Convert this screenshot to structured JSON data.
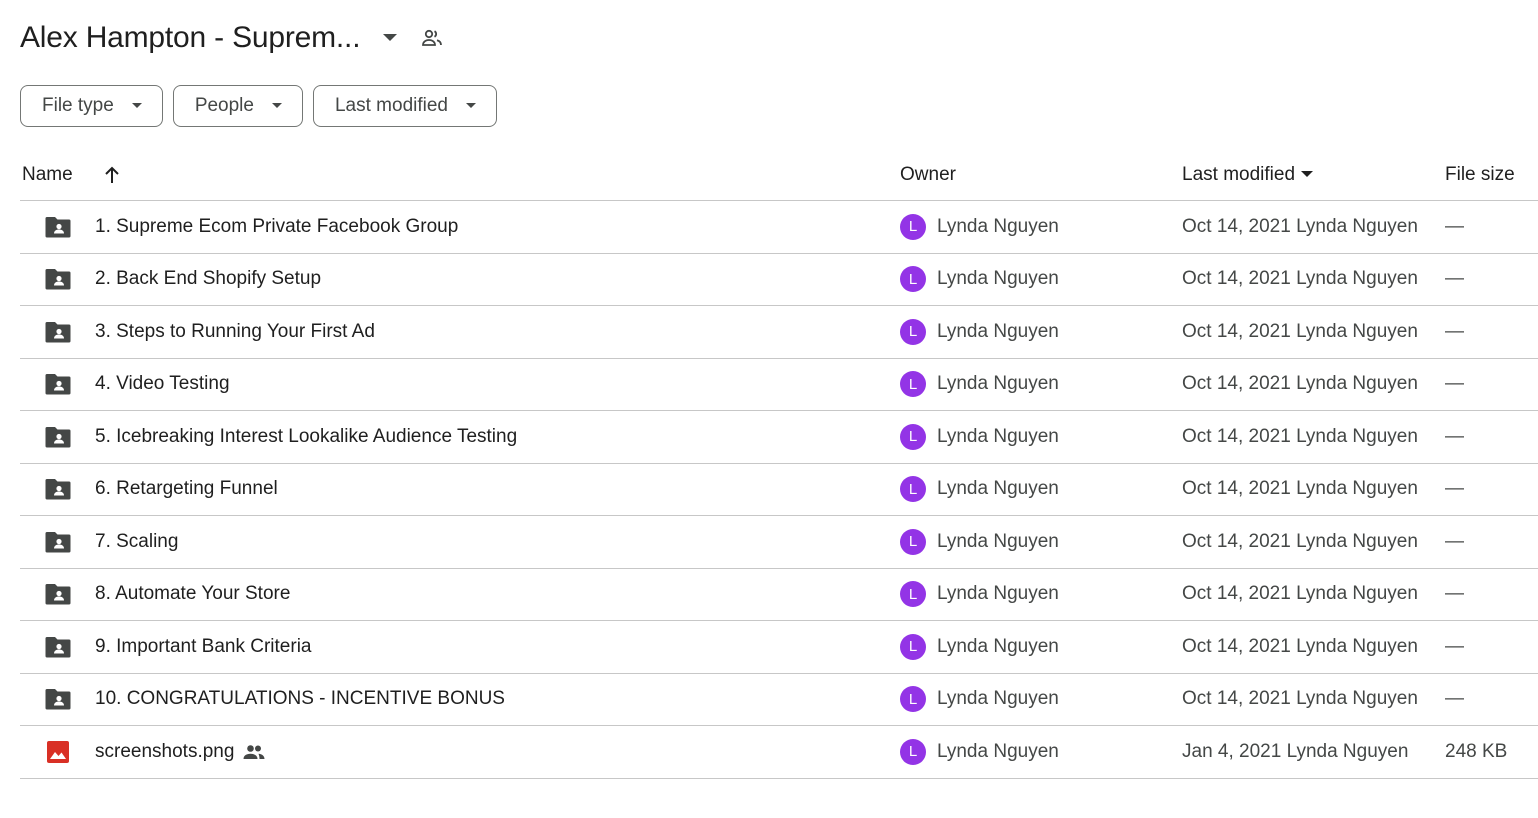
{
  "header": {
    "title": "Alex Hampton - Suprem...",
    "caret_icon": "arrow-drop-down-icon",
    "share_icon": "people-icon"
  },
  "filters": [
    {
      "label": "File type"
    },
    {
      "label": "People"
    },
    {
      "label": "Last modified"
    }
  ],
  "table": {
    "columns": {
      "name": "Name",
      "owner": "Owner",
      "last_modified": "Last modified",
      "file_size": "File size"
    },
    "sort_icon": "arrow-upward-icon",
    "rows": [
      {
        "type": "shared-folder",
        "name": "1. Supreme Ecom Private Facebook Group",
        "owner_initial": "L",
        "owner": "Lynda Nguyen",
        "modified": "Oct 14, 2021 Lynda Nguyen",
        "size": "—"
      },
      {
        "type": "shared-folder",
        "name": "2. Back End Shopify Setup",
        "owner_initial": "L",
        "owner": "Lynda Nguyen",
        "modified": "Oct 14, 2021 Lynda Nguyen",
        "size": "—"
      },
      {
        "type": "shared-folder",
        "name": "3. Steps to Running Your First Ad",
        "owner_initial": "L",
        "owner": "Lynda Nguyen",
        "modified": "Oct 14, 2021 Lynda Nguyen",
        "size": "—"
      },
      {
        "type": "shared-folder",
        "name": "4. Video Testing",
        "owner_initial": "L",
        "owner": "Lynda Nguyen",
        "modified": "Oct 14, 2021 Lynda Nguyen",
        "size": "—"
      },
      {
        "type": "shared-folder",
        "name": "5. Icebreaking Interest Lookalike Audience Testing",
        "owner_initial": "L",
        "owner": "Lynda Nguyen",
        "modified": "Oct 14, 2021 Lynda Nguyen",
        "size": "—"
      },
      {
        "type": "shared-folder",
        "name": "6. Retargeting Funnel",
        "owner_initial": "L",
        "owner": "Lynda Nguyen",
        "modified": "Oct 14, 2021 Lynda Nguyen",
        "size": "—"
      },
      {
        "type": "shared-folder",
        "name": "7. Scaling",
        "owner_initial": "L",
        "owner": "Lynda Nguyen",
        "modified": "Oct 14, 2021 Lynda Nguyen",
        "size": "—"
      },
      {
        "type": "shared-folder",
        "name": "8. Automate Your Store",
        "owner_initial": "L",
        "owner": "Lynda Nguyen",
        "modified": "Oct 14, 2021 Lynda Nguyen",
        "size": "—"
      },
      {
        "type": "shared-folder",
        "name": "9. Important Bank Criteria",
        "owner_initial": "L",
        "owner": "Lynda Nguyen",
        "modified": "Oct 14, 2021 Lynda Nguyen",
        "size": "—"
      },
      {
        "type": "shared-folder",
        "name": "10. CONGRATULATIONS - INCENTIVE BONUS",
        "owner_initial": "L",
        "owner": "Lynda Nguyen",
        "modified": "Oct 14, 2021 Lynda Nguyen",
        "size": "—"
      },
      {
        "type": "image",
        "name": "screenshots.png",
        "shared": true,
        "owner_initial": "L",
        "owner": "Lynda Nguyen",
        "modified": "Jan 4, 2021 Lynda Nguyen",
        "size": "248 KB"
      }
    ]
  },
  "colors": {
    "avatar": "#9334e6",
    "folder_icon": "#444746",
    "image_icon": "#d93025",
    "divider": "#c7c7c7"
  }
}
